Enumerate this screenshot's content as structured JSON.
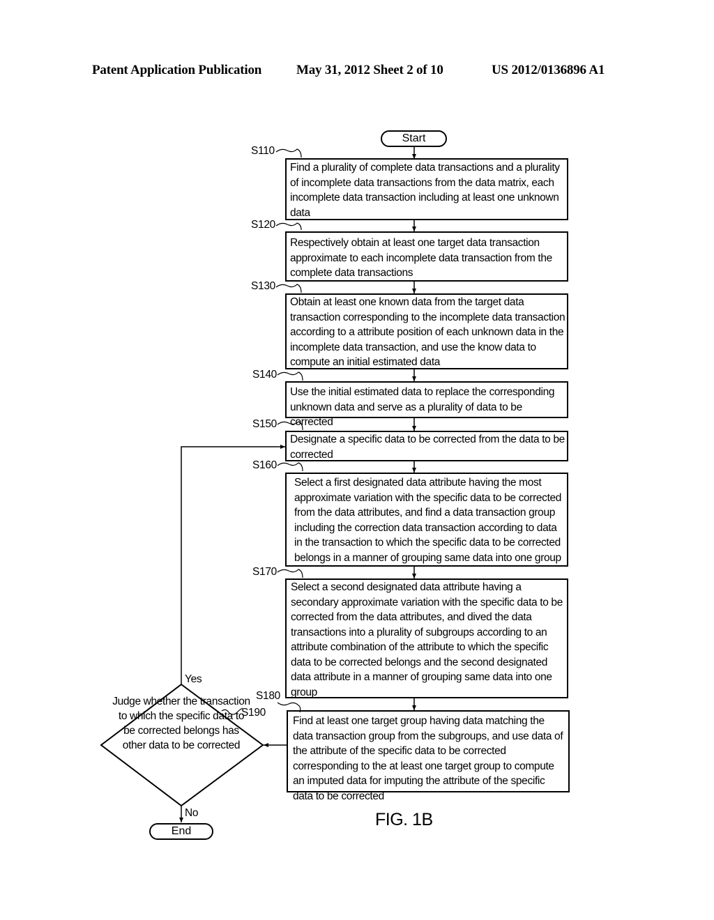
{
  "header": {
    "publication": "Patent Application Publication",
    "date_sheet": "May 31, 2012  Sheet 2 of 10",
    "number": "US 2012/0136896 A1"
  },
  "flowchart": {
    "start": "Start",
    "end": "End",
    "steps": [
      {
        "id": "S110",
        "text": "Find a plurality of complete data transactions and a plurality of incomplete data transactions from the data matrix, each incomplete data transaction including at least one unknown data"
      },
      {
        "id": "S120",
        "text": "Respectively obtain at least one target data transaction approximate to each incomplete data transaction from the complete data transactions"
      },
      {
        "id": "S130",
        "text": "Obtain at least one known data from the target data transaction corresponding to the incomplete data transaction according to a attribute position of each unknown data in the incomplete data transaction, and use the know data to compute an initial estimated data"
      },
      {
        "id": "S140",
        "text": "Use the initial estimated data to replace the corresponding unknown data and serve as a plurality of data to be corrected"
      },
      {
        "id": "S150",
        "text": "Designate a specific data to be corrected from the data to be corrected"
      },
      {
        "id": "S160",
        "text": "Select a first designated data attribute having the most approximate variation with the specific data to be corrected from the data attributes, and find a data transaction group including the correction data transaction according to data in the transaction to which the specific data to be corrected belongs in a manner of grouping same data into one group"
      },
      {
        "id": "S170",
        "text": "Select a second designated data attribute having a secondary approximate variation with the specific data to be corrected from the data attributes, and dived the data transactions into a plurality of subgroups according to an attribute combination of the attribute to which the specific data to be corrected belongs and the second designated data attribute in a manner of grouping same data into one group"
      },
      {
        "id": "S180",
        "text": "Find at least one target group having data matching the data transaction group from the subgroups, and use data of the attribute of the specific data to be corrected corresponding to the at least one target group to compute an imputed data for imputing the attribute of the specific data to be corrected"
      }
    ],
    "decision": {
      "id": "S190",
      "text": "Judge whether the transaction to which the specific data to be corrected belongs has other data to be corrected",
      "yes_label": "Yes",
      "no_label": "No"
    }
  },
  "figure_label": "FIG. 1B"
}
